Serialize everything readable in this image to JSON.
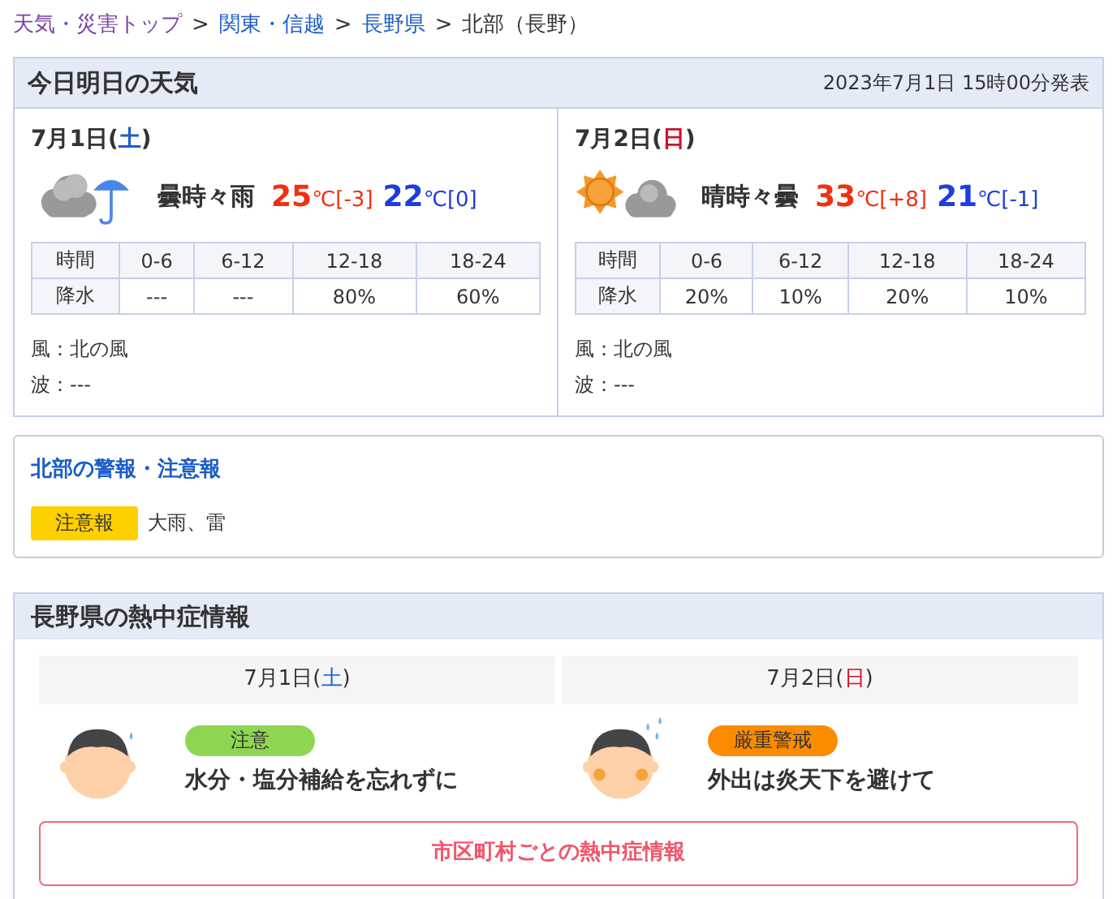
{
  "breadcrumb": [
    {
      "kind": "link",
      "text": "天気・災害トップ",
      "visited": true
    },
    {
      "kind": "separator",
      "text": ">"
    },
    {
      "kind": "link",
      "text": "関東・信越",
      "visited": false
    },
    {
      "kind": "separator",
      "text": ">"
    },
    {
      "kind": "link",
      "text": "長野県",
      "visited": false
    },
    {
      "kind": "separator",
      "text": ">"
    },
    {
      "kind": "current",
      "text": "北部（長野）"
    }
  ],
  "forecast": {
    "title": "今日明日の天気",
    "issued": "2023年7月1日 15時00分発表",
    "days": [
      {
        "date": "7月1日(",
        "weekday": {
          "kind": "saturday",
          "text": "土"
        },
        "close": ")",
        "icon": {
          "kind": "cloud_rain"
        },
        "weather": "曇時々雨",
        "high": {
          "value": "25",
          "unit": "℃",
          "diff": "[-3]"
        },
        "low": {
          "value": "22",
          "unit": "℃",
          "diff": "[0]"
        },
        "header": [
          "時間",
          "0-6",
          "6-12",
          "12-18",
          "18-24"
        ],
        "rain": [
          "降水",
          "---",
          "---",
          "80%",
          "60%"
        ],
        "wind": "風：北の風",
        "wave": "波：---"
      },
      {
        "date": "7月2日(",
        "weekday": {
          "kind": "sunday",
          "text": "日"
        },
        "close": ")",
        "icon": {
          "kind": "sun_cloud"
        },
        "weather": "晴時々曇",
        "high": {
          "value": "33",
          "unit": "℃",
          "diff": "[+8]"
        },
        "low": {
          "value": "21",
          "unit": "℃",
          "diff": "[-1]"
        },
        "header": [
          "時間",
          "0-6",
          "6-12",
          "12-18",
          "18-24"
        ],
        "rain": [
          "降水",
          "20%",
          "10%",
          "20%",
          "10%"
        ],
        "wind": "風：北の風",
        "wave": "波：---"
      }
    ]
  },
  "warnings": {
    "title": "北部の警報・注意報",
    "items": [
      {
        "kind": "advisory",
        "label": "注意報",
        "text": "大雨、雷"
      }
    ]
  },
  "heatstroke": {
    "title": "長野県の熱中症情報",
    "days": [
      {
        "date": "7月1日(",
        "weekday": {
          "kind": "saturday",
          "text": "土"
        },
        "close": ")",
        "level": {
          "kind": "caution",
          "text": "注意"
        },
        "message": "水分・塩分補給を忘れずに"
      },
      {
        "date": "7月2日(",
        "weekday": {
          "kind": "sunday",
          "text": "日"
        },
        "close": ")",
        "level": {
          "kind": "severe",
          "text": "厳重警戒"
        },
        "message": "外出は炎天下を避けて"
      }
    ],
    "link": "市区町村ごとの熱中症情報"
  }
}
